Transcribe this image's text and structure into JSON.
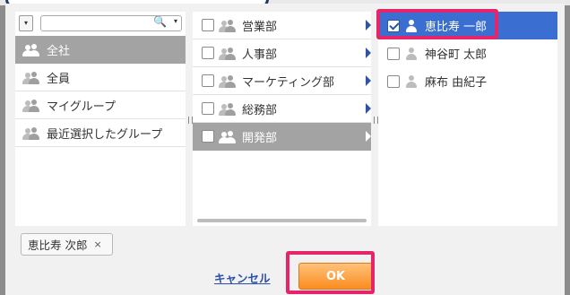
{
  "toolbar": {
    "dropdown_caret": "▾",
    "search_value": "",
    "search_icon": "🔍",
    "search_caret": "▾"
  },
  "groups": [
    {
      "label": "全社",
      "selected": true
    },
    {
      "label": "全員",
      "selected": false
    },
    {
      "label": "マイグループ",
      "selected": false
    },
    {
      "label": "最近選択したグループ",
      "selected": false
    }
  ],
  "departments": [
    {
      "label": "営業部",
      "checked": false,
      "selected": false
    },
    {
      "label": "人事部",
      "checked": false,
      "selected": false
    },
    {
      "label": "マーケティング部",
      "checked": false,
      "selected": false
    },
    {
      "label": "総務部",
      "checked": false,
      "selected": false
    },
    {
      "label": "開発部",
      "checked": false,
      "selected": true
    }
  ],
  "users": [
    {
      "label": "恵比寿 一郎",
      "checked": true,
      "selected": true
    },
    {
      "label": "神谷町 太郎",
      "checked": false,
      "selected": false
    },
    {
      "label": "麻布 由紀子",
      "checked": false,
      "selected": false
    }
  ],
  "selected_chip": {
    "label": "恵比寿 次郎",
    "remove": "×"
  },
  "footer": {
    "cancel_label": "キャンセル",
    "ok_label": "OK"
  },
  "colors": {
    "accent_blue": "#3a6ed0",
    "highlight_pink": "#e5246a",
    "ok_orange": "#fa8c1f",
    "link_blue": "#2a4fae"
  }
}
